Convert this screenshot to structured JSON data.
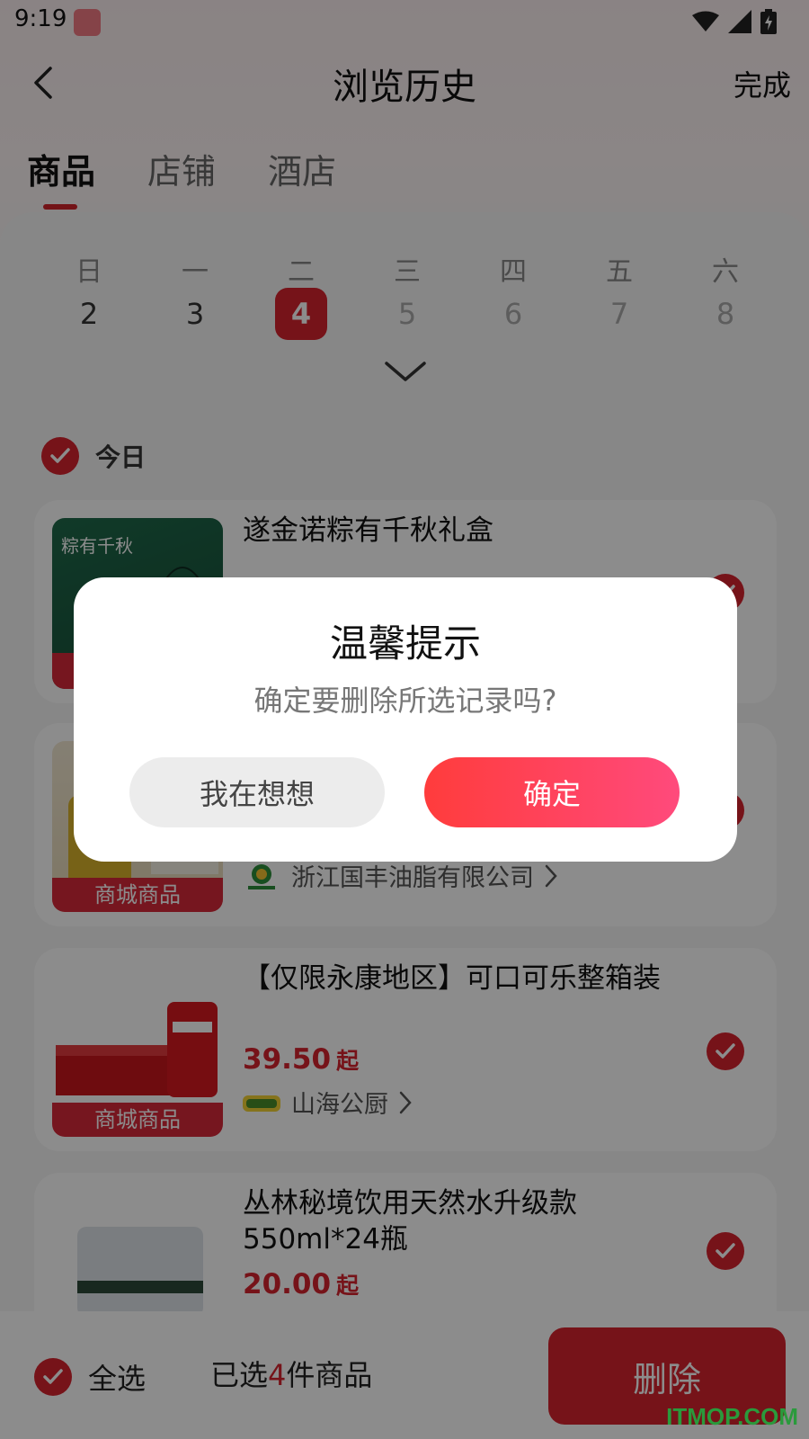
{
  "status_bar": {
    "time": "9:19"
  },
  "header": {
    "title": "浏览历史",
    "done_label": "完成"
  },
  "tabs": [
    {
      "label": "商品",
      "active": true
    },
    {
      "label": "店铺",
      "active": false
    },
    {
      "label": "酒店",
      "active": false
    }
  ],
  "calendar": {
    "weekdays": [
      "日",
      "一",
      "二",
      "三",
      "四",
      "五",
      "六"
    ],
    "days": [
      "2",
      "3",
      "4",
      "5",
      "6",
      "7",
      "8"
    ],
    "selected_day": "4"
  },
  "section": {
    "title": "今日"
  },
  "products": [
    {
      "title": "遂金诺粽有千秋礼盒",
      "tag": "",
      "price": "",
      "price_suffix": "",
      "shop": ""
    },
    {
      "title": "",
      "tag": "商城商品",
      "price": "",
      "price_suffix": "",
      "shop": "浙江国丰油脂有限公司"
    },
    {
      "title": "【仅限永康地区】可口可乐整箱装",
      "tag": "商城商品",
      "price": "39.50",
      "price_suffix": "起",
      "shop": "山海公厨"
    },
    {
      "title": "丛林秘境饮用天然水升级款550ml*24瓶",
      "tag": "",
      "price": "20.00",
      "price_suffix": "起",
      "shop": ""
    }
  ],
  "bottom_bar": {
    "select_all_label": "全选",
    "selected_prefix": "已选",
    "selected_count": "4",
    "selected_suffix": "件商品",
    "delete_label": "删除"
  },
  "dialog": {
    "title": "温馨提示",
    "message": "确定要删除所选记录吗?",
    "cancel_label": "我在想想",
    "confirm_label": "确定"
  },
  "watermark": "ITMOP.COM",
  "colors": {
    "accent": "#d8232f",
    "confirm_gradient_start": "#ff3c3c",
    "confirm_gradient_end": "#ff4a7c"
  }
}
